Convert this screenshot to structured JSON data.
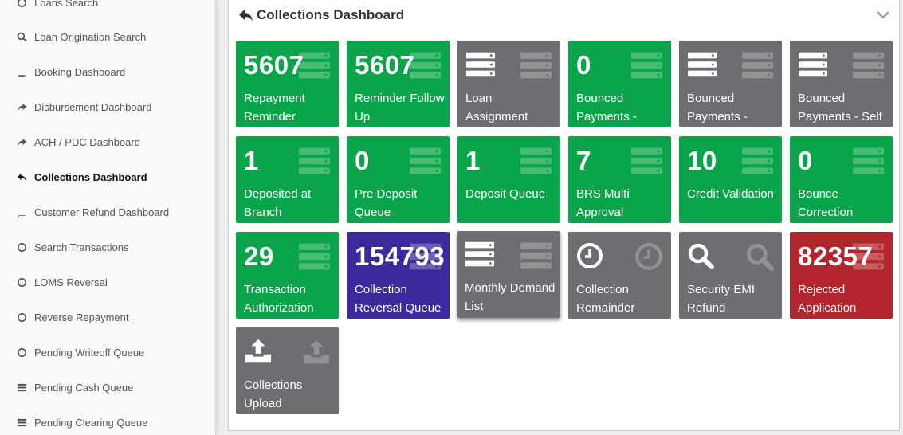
{
  "sidebar": {
    "items": [
      {
        "label": "Loans Search",
        "icon": "circle-icon"
      },
      {
        "label": "Loan Origination Search",
        "icon": "search-icon"
      },
      {
        "label": "Booking Dashboard",
        "icon": "book-icon"
      },
      {
        "label": "Disbursement Dashboard",
        "icon": "share-icon"
      },
      {
        "label": "ACH / PDC Dashboard",
        "icon": "share-icon"
      },
      {
        "label": "Collections Dashboard",
        "icon": "reply-icon",
        "active": true
      },
      {
        "label": "Customer Refund Dashboard",
        "icon": "book-icon"
      },
      {
        "label": "Search Transactions",
        "icon": "circle-icon"
      },
      {
        "label": "LOMS Reversal",
        "icon": "circle-icon"
      },
      {
        "label": "Reverse Repayment",
        "icon": "circle-icon"
      },
      {
        "label": "Pending Writeoff Queue",
        "icon": "circle-icon"
      },
      {
        "label": "Pending Cash Queue",
        "icon": "list-icon"
      },
      {
        "label": "Pending Clearing Queue",
        "icon": "list-icon"
      }
    ]
  },
  "panel": {
    "title": "Collections Dashboard",
    "icon": "reply-icon",
    "collapse_icon": "chevron-down-icon"
  },
  "colors": {
    "green": "#0aa54a",
    "gray": "#6e6e72",
    "purple": "#3c2a9c",
    "red": "#b3262d"
  },
  "tiles": [
    {
      "count": "5607",
      "label": "Repayment Reminder",
      "color": "green",
      "icon": "server-icon"
    },
    {
      "count": "5607",
      "label": "Reminder Follow Up",
      "color": "green",
      "icon": "server-icon"
    },
    {
      "count": "",
      "label": "Loan Assignment",
      "color": "gray",
      "icon": "server-icon"
    },
    {
      "count": "0",
      "label": "Bounced Payments -",
      "color": "green",
      "icon": "server-icon"
    },
    {
      "count": "",
      "label": "Bounced Payments -",
      "color": "gray",
      "icon": "server-icon"
    },
    {
      "count": "",
      "label": "Bounced Payments - Self",
      "color": "gray",
      "icon": "server-icon"
    },
    {
      "count": "1",
      "label": "Deposited at Branch",
      "color": "green",
      "icon": "server-icon"
    },
    {
      "count": "0",
      "label": "Pre Deposit Queue",
      "color": "green",
      "icon": "server-icon"
    },
    {
      "count": "1",
      "label": "Deposit Queue",
      "color": "green",
      "icon": "server-icon"
    },
    {
      "count": "7",
      "label": "BRS Multi Approval",
      "color": "green",
      "icon": "server-icon"
    },
    {
      "count": "10",
      "label": "Credit Validation",
      "color": "green",
      "icon": "server-icon"
    },
    {
      "count": "0",
      "label": "Bounce Correction",
      "color": "green",
      "icon": "server-icon"
    },
    {
      "count": "29",
      "label": "Transaction Authorization",
      "color": "green",
      "icon": "server-icon"
    },
    {
      "count": "154793",
      "label": "Collection Reversal Queue",
      "color": "purple",
      "icon": "server-icon"
    },
    {
      "count": "",
      "label": "Monthly Demand List",
      "color": "gray",
      "icon": "server-icon"
    },
    {
      "count": "",
      "label": "Collection Remainder",
      "color": "gray",
      "icon": "clock-icon"
    },
    {
      "count": "",
      "label": "Security EMI Refund",
      "color": "gray",
      "icon": "search-icon"
    },
    {
      "count": "82357",
      "label": "Rejected Application",
      "color": "red",
      "icon": "server-icon"
    },
    {
      "count": "",
      "label": "Collections Upload",
      "color": "gray",
      "icon": "upload-icon"
    }
  ]
}
